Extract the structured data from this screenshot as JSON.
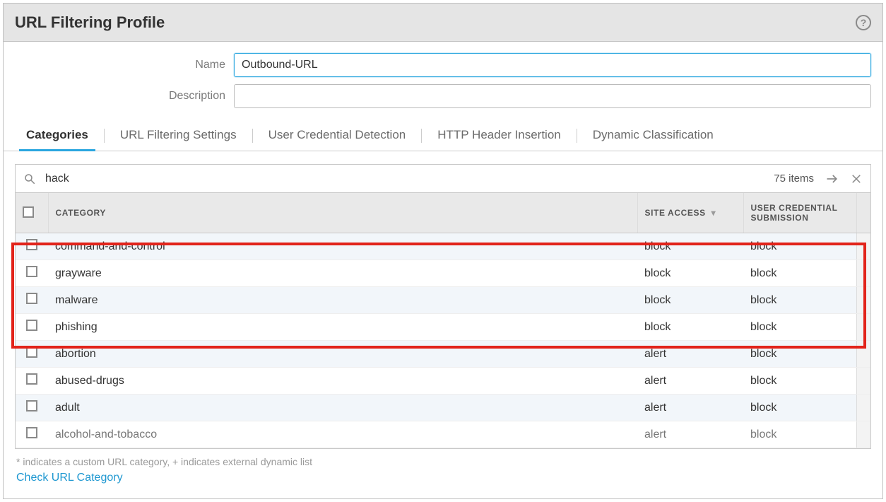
{
  "header": {
    "title": "URL Filtering Profile",
    "help_icon": "?"
  },
  "form": {
    "name_label": "Name",
    "name_value": "Outbound-URL",
    "description_label": "Description",
    "description_value": ""
  },
  "tabs": [
    {
      "label": "Categories",
      "active": true
    },
    {
      "label": "URL Filtering Settings",
      "active": false
    },
    {
      "label": "User Credential Detection",
      "active": false
    },
    {
      "label": "HTTP Header Insertion",
      "active": false
    },
    {
      "label": "Dynamic Classification",
      "active": false
    }
  ],
  "search": {
    "value": "hack",
    "items_count": "75 items"
  },
  "columns": {
    "category": "CATEGORY",
    "site_access": "SITE ACCESS",
    "user_cred": "USER CREDENTIAL SUBMISSION"
  },
  "rows": [
    {
      "category": "command-and-control",
      "site_access": "block",
      "user_cred": "block",
      "alt": true,
      "hl": true
    },
    {
      "category": "grayware",
      "site_access": "block",
      "user_cred": "block",
      "alt": false,
      "hl": true
    },
    {
      "category": "malware",
      "site_access": "block",
      "user_cred": "block",
      "alt": true,
      "hl": true
    },
    {
      "category": "phishing",
      "site_access": "block",
      "user_cred": "block",
      "alt": false,
      "hl": true
    },
    {
      "category": "abortion",
      "site_access": "alert",
      "user_cred": "block",
      "alt": true,
      "hl": false
    },
    {
      "category": "abused-drugs",
      "site_access": "alert",
      "user_cred": "block",
      "alt": false,
      "hl": false
    },
    {
      "category": "adult",
      "site_access": "alert",
      "user_cred": "block",
      "alt": true,
      "hl": false
    },
    {
      "category": "alcohol-and-tobacco",
      "site_access": "alert",
      "user_cred": "block",
      "alt": false,
      "hl": false
    }
  ],
  "footnote": "* indicates a custom URL category, + indicates external dynamic list",
  "check_link": "Check URL Category"
}
